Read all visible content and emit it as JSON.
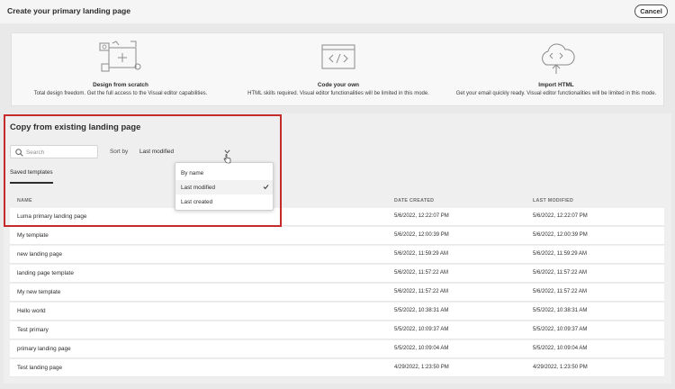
{
  "header": {
    "title": "Create your primary landing page",
    "cancel_label": "Cancel"
  },
  "options": [
    {
      "title": "Design from scratch",
      "description": "Total design freedom. Get the full access to the Visual editor capabilities.",
      "icon": "design-canvas-icon"
    },
    {
      "title": "Code your own",
      "description": "HTML skills required. Visual editor functionalities will be limited in this mode.",
      "icon": "code-window-icon"
    },
    {
      "title": "Import HTML",
      "description": "Get your email quickly ready. Visual editor functionalities will be limited in this mode.",
      "icon": "cloud-upload-icon"
    }
  ],
  "copy_section": {
    "title": "Copy from existing landing page",
    "search_placeholder": "Search",
    "sort_label": "Sort by",
    "sort_value": "Last modified",
    "tab_label": "Saved templates"
  },
  "sort_menu": {
    "items": [
      "By name",
      "Last modified",
      "Last created"
    ],
    "selected": "Last modified"
  },
  "table": {
    "columns": [
      "NAME",
      "DATE CREATED",
      "LAST MODIFIED"
    ],
    "rows": [
      {
        "name": "Luma primary landing page",
        "created": "5/6/2022, 12:22:07 PM",
        "modified": "5/6/2022, 12:22:07 PM"
      },
      {
        "name": "My template",
        "created": "5/6/2022, 12:00:39 PM",
        "modified": "5/6/2022, 12:00:39 PM"
      },
      {
        "name": "new landing page",
        "created": "5/6/2022, 11:59:29 AM",
        "modified": "5/6/2022, 11:59:29 AM"
      },
      {
        "name": "landing page template",
        "created": "5/6/2022, 11:57:22 AM",
        "modified": "5/6/2022, 11:57:22 AM"
      },
      {
        "name": "My new template",
        "created": "5/6/2022, 11:57:22 AM",
        "modified": "5/6/2022, 11:57:22 AM"
      },
      {
        "name": "Hello world",
        "created": "5/5/2022, 10:38:31 AM",
        "modified": "5/5/2022, 10:38:31 AM"
      },
      {
        "name": "Test primary",
        "created": "5/5/2022, 10:09:37 AM",
        "modified": "5/5/2022, 10:09:37 AM"
      },
      {
        "name": " primary landing page",
        "created": "5/5/2022, 10:09:04 AM",
        "modified": "5/5/2022, 10:09:04 AM"
      },
      {
        "name": "Test landing page",
        "created": "4/29/2022, 1:23:50 PM",
        "modified": "4/29/2022, 1:23:50 PM"
      }
    ]
  },
  "colors": {
    "highlight_border": "#c52b2b",
    "background": "#e9e9e9",
    "row_background": "#ffffff"
  }
}
